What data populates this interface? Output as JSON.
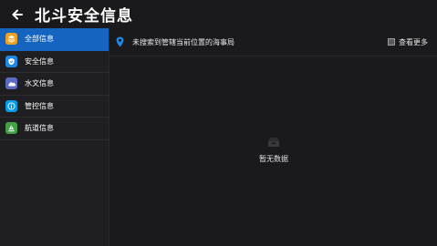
{
  "header": {
    "title": "北斗安全信息",
    "back_icon": "arrow-left-icon"
  },
  "sidebar": {
    "items": [
      {
        "label": "全部信息",
        "icon": "layers-icon",
        "color": "#f0a020",
        "active": true
      },
      {
        "label": "安全信息",
        "icon": "shield-icon",
        "color": "#1e88e5",
        "active": false
      },
      {
        "label": "水文信息",
        "icon": "cloud-icon",
        "color": "#5c6bc0",
        "active": false
      },
      {
        "label": "管控信息",
        "icon": "info-icon",
        "color": "#039be5",
        "active": false
      },
      {
        "label": "航道信息",
        "icon": "ship-icon",
        "color": "#43a047",
        "active": false
      }
    ]
  },
  "main": {
    "location_text": "未搜索到管辖当前位置的海事局",
    "more_label": "查看更多",
    "empty_text": "暂无数据"
  },
  "colors": {
    "accent": "#1565c0",
    "background": "#1a1a1d",
    "location_pin": "#1e88e5"
  }
}
